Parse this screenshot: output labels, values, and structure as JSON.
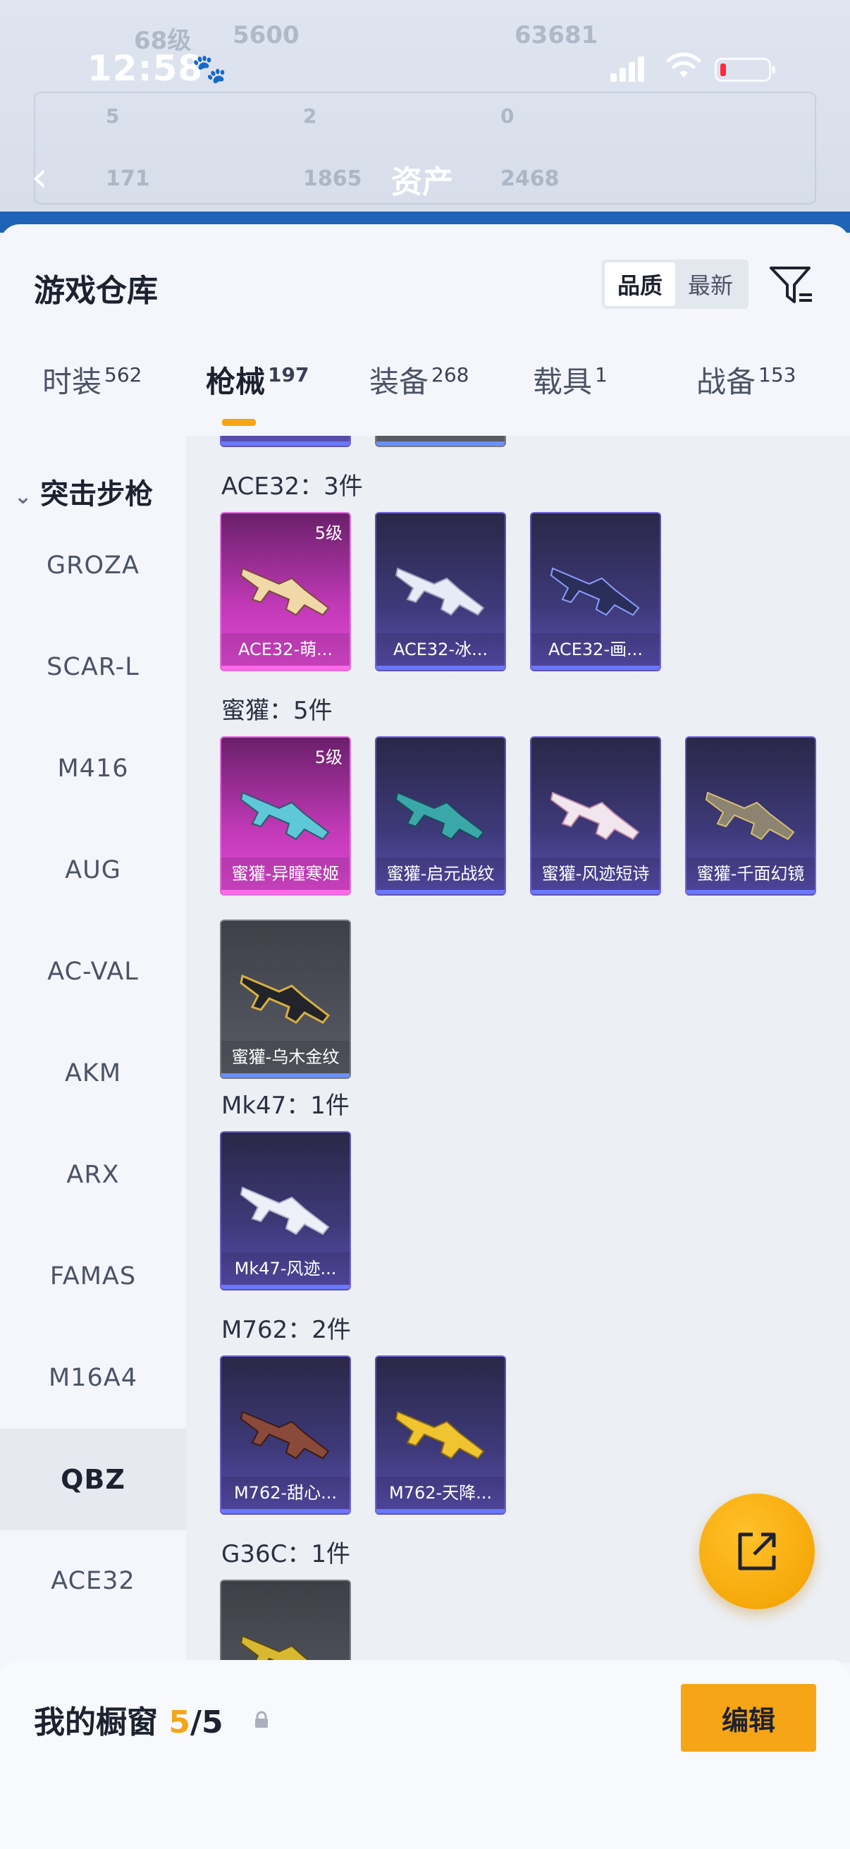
{
  "status_bar": {
    "time": "12:58"
  },
  "header": {
    "title": "资产",
    "ghost_texts": [
      "68级",
      "5600",
      "5",
      "2",
      "0",
      "171",
      "1865",
      "2468",
      "63681"
    ]
  },
  "sheet": {
    "title": "游戏仓库",
    "sort_options": [
      "品质",
      "最新"
    ],
    "active_sort": "品质"
  },
  "tabs": [
    {
      "label": "时装",
      "count": "562"
    },
    {
      "label": "枪械",
      "count": "197"
    },
    {
      "label": "装备",
      "count": "268"
    },
    {
      "label": "载具",
      "count": "1"
    },
    {
      "label": "战备",
      "count": "153"
    }
  ],
  "sidebar": {
    "category": "突击步枪",
    "items": [
      "GROZA",
      "SCAR-L",
      "M416",
      "AUG",
      "AC-VAL",
      "AKM",
      "ARX",
      "FAMAS",
      "M16A4",
      "QBZ",
      "ACE32"
    ],
    "active": "QBZ"
  },
  "groups": [
    {
      "label": "ACE32：3件",
      "items": [
        {
          "name": "ACE32-萌...",
          "tier": "5级",
          "rarity": "pink"
        },
        {
          "name": "ACE32-冰...",
          "tier": "",
          "rarity": "purple"
        },
        {
          "name": "ACE32-画...",
          "tier": "",
          "rarity": "purple"
        }
      ]
    },
    {
      "label": "蜜獾：5件",
      "items": [
        {
          "name": "蜜獾-异瞳寒姬",
          "tier": "5级",
          "rarity": "pink"
        },
        {
          "name": "蜜獾-启元战纹",
          "tier": "",
          "rarity": "purple"
        },
        {
          "name": "蜜獾-风迹短诗",
          "tier": "",
          "rarity": "purple"
        },
        {
          "name": "蜜獾-千面幻镜",
          "tier": "",
          "rarity": "purple"
        },
        {
          "name": "蜜獾-乌木金纹",
          "tier": "",
          "rarity": "gray"
        }
      ]
    },
    {
      "label": "Mk47：1件",
      "items": [
        {
          "name": "Mk47-风迹...",
          "tier": "",
          "rarity": "purple"
        }
      ]
    },
    {
      "label": "M762：2件",
      "items": [
        {
          "name": "M762-甜心...",
          "tier": "",
          "rarity": "purple"
        },
        {
          "name": "M762-天降...",
          "tier": "",
          "rarity": "purple"
        }
      ]
    },
    {
      "label": "G36C：1件",
      "items": []
    }
  ],
  "showcase": {
    "title": "我的橱窗",
    "current": "5",
    "total": "/5",
    "edit_label": "编辑"
  },
  "colors": {
    "accent": "#f5a515",
    "pink": "#c23ab8",
    "purple": "#3e3a7a",
    "gray": "#5a5c66"
  },
  "icons": [
    "back-icon",
    "filter-icon",
    "share-icon",
    "lock-icon",
    "chevron-down-icon",
    "gun-icon"
  ]
}
